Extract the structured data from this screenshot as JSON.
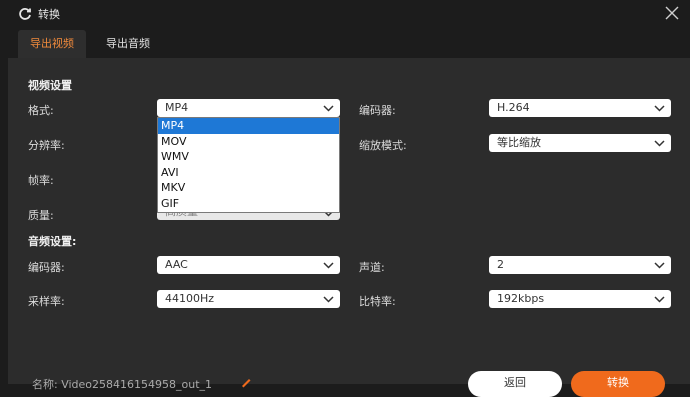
{
  "window": {
    "title": "转换"
  },
  "tabs": [
    {
      "label": "导出视频"
    },
    {
      "label": "导出音频"
    }
  ],
  "video_settings": {
    "heading": "视频设置",
    "format": {
      "label": "格式:",
      "value": "MP4"
    },
    "resolution": {
      "label": "分辨率:"
    },
    "framerate": {
      "label": "帧率:"
    },
    "quality": {
      "label": "质量:",
      "value": "高质量"
    },
    "encoder": {
      "label": "编码器:",
      "value": "H.264"
    },
    "scale_mode": {
      "label": "缩放模式:",
      "value": "等比缩放"
    }
  },
  "format_dropdown": {
    "options": [
      "MP4",
      "MOV",
      "WMV",
      "AVI",
      "MKV",
      "GIF"
    ],
    "selected": "MP4"
  },
  "audio_settings": {
    "heading": "音频设置:",
    "encoder": {
      "label": "编码器:",
      "value": "AAC"
    },
    "samplerate": {
      "label": "采样率:",
      "value": "44100Hz"
    },
    "channels": {
      "label": "声道:",
      "value": "2"
    },
    "bitrate": {
      "label": "比特率:",
      "value": "192kbps"
    }
  },
  "footer": {
    "filename": "名称: Video258416154958_out_1",
    "back_label": "返回",
    "convert_label": "转换"
  },
  "colors": {
    "accent": "#f08a3c",
    "convert_button": "#f06a1c",
    "selection": "#1e78d6",
    "panel": "#2c2c2c",
    "background": "#1c1c1c"
  }
}
